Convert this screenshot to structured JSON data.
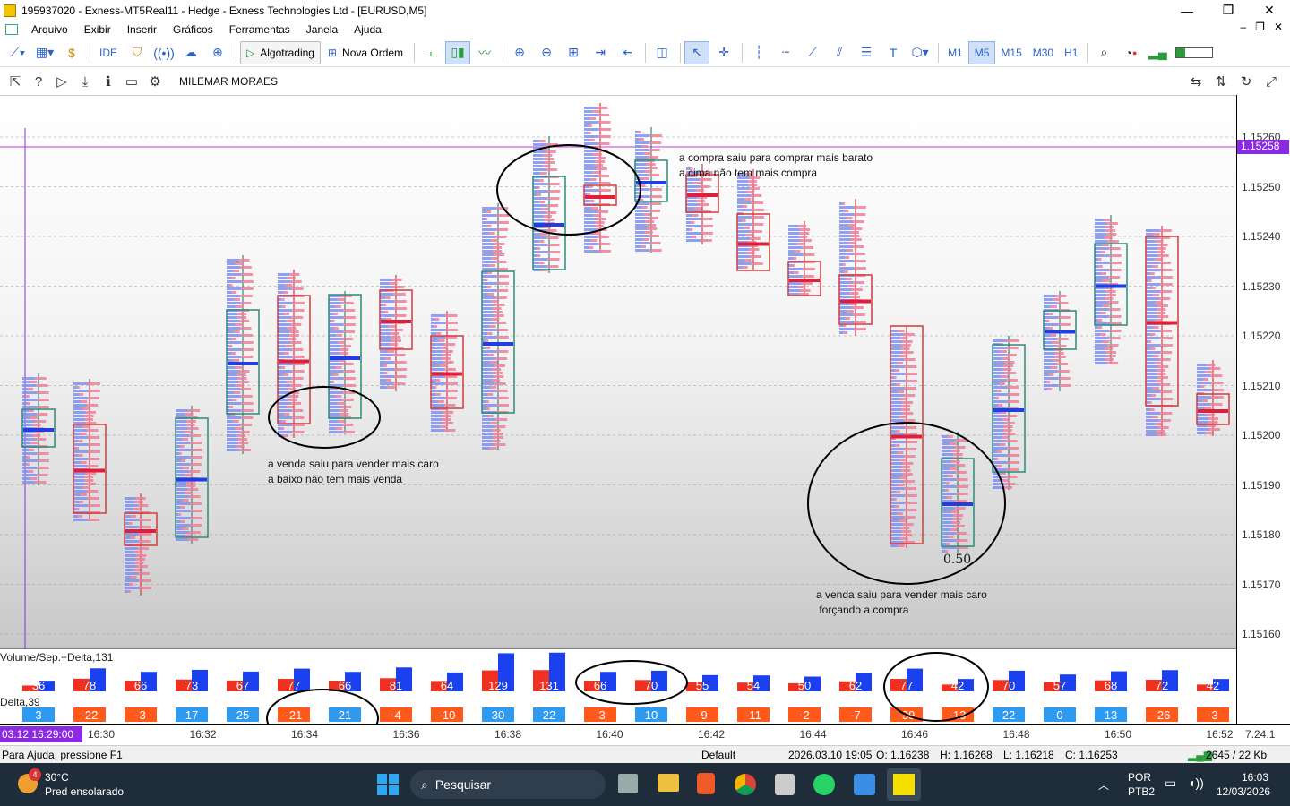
{
  "window": {
    "title": "195937020 - Exness-MT5Real11 - Hedge - Exness Technologies Ltd - [EURUSD,M5]"
  },
  "menu": [
    "Arquivo",
    "Exibir",
    "Inserir",
    "Gráficos",
    "Ferramentas",
    "Janela",
    "Ajuda"
  ],
  "toolbar": {
    "ide": "IDE",
    "algotrading": "Algotrading",
    "nova_ordem": "Nova Ordem",
    "timeframes": [
      "M1",
      "M5",
      "M15",
      "M30",
      "H1"
    ],
    "active_tf": "M5"
  },
  "chart": {
    "indicator_name": "MILEMAR MORAES",
    "current_price": "1.15258",
    "price_labels": [
      "1.15260",
      "1.15250",
      "1.15240",
      "1.15230",
      "1.15220",
      "1.15210",
      "1.15200",
      "1.15190",
      "1.15180",
      "1.15170",
      "1.15160"
    ],
    "time_labels": [
      "16:30",
      "16:32",
      "16:34",
      "16:36",
      "16:38",
      "16:40",
      "16:42",
      "16:44",
      "16:46",
      "16:48",
      "16:50",
      "16:52"
    ],
    "cursor_time": "03.12 16:29:00",
    "right_time": "7.24.1",
    "subwindow1_label": "Volume/Sep.+Delta,131",
    "subwindow2_label": "Delta,39",
    "volumes": [
      "36",
      "78",
      "66",
      "73",
      "67",
      "77",
      "66",
      "81",
      "64",
      "129",
      "131",
      "66",
      "70",
      "55",
      "54",
      "50",
      "62",
      "77",
      "42",
      "70",
      "57",
      "68",
      "72",
      "42"
    ],
    "deltas": [
      "3",
      "-22",
      "-3",
      "17",
      "25",
      "-21",
      "21",
      "-4",
      "-10",
      "30",
      "22",
      "-3",
      "10",
      "-9",
      "-11",
      "-2",
      "-7",
      "-39",
      "-13",
      "22",
      "0",
      "13",
      "-26",
      "-3"
    ],
    "annotations": {
      "a1_line1": "a compra saiu para comprar mais barato",
      "a1_line2": "a cima não tem mais compra",
      "a2_line1": "a venda saiu para vender mais caro",
      "a2_line2": "a baixo não tem mais venda",
      "a3_line1": "a venda saiu para vender mais caro",
      "a3_line2": " forçando a compra",
      "value_label": "0.50"
    }
  },
  "status": {
    "help": "Para Ajuda, pressione F1",
    "profile": "Default",
    "datetime": "2026.03.10 19:05",
    "open": "O: 1.16238",
    "high": "H: 1.16268",
    "low": "L: 1.16218",
    "close": "C: 1.16253",
    "traffic": "2645 / 22 Kb"
  },
  "taskbar": {
    "temp": "30°C",
    "weather": "Pred ensolarado",
    "search": "Pesquisar",
    "lang1": "POR",
    "lang2": "PTB2",
    "time": "16:03",
    "date": "12/03/2026",
    "badge": "4"
  }
}
